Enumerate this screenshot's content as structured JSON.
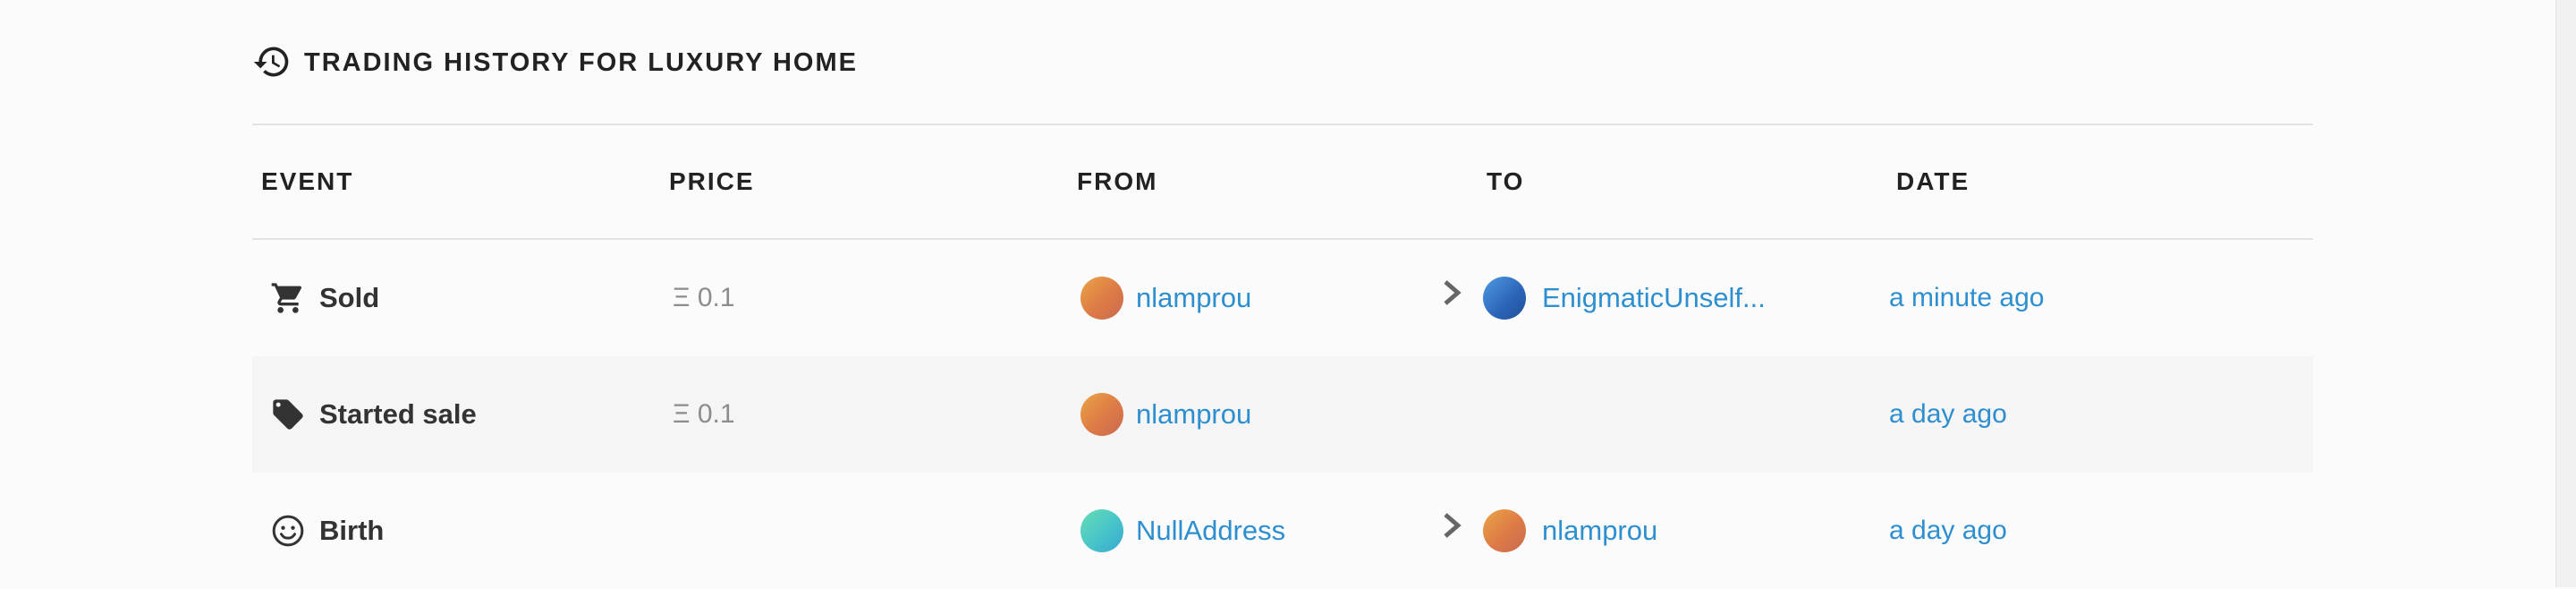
{
  "header": {
    "title": "TRADING HISTORY FOR LUXURY HOME",
    "icon": "history-icon"
  },
  "columns": {
    "event": "EVENT",
    "price": "PRICE",
    "from": "FROM",
    "to": "TO",
    "date": "DATE"
  },
  "rows": [
    {
      "event": "Sold",
      "event_icon": "cart-icon",
      "price": "Ξ 0.1",
      "from": "nlamprou",
      "from_avatar": "orange",
      "to": "EnigmaticUnself...",
      "to_avatar": "blue",
      "date": "a minute ago"
    },
    {
      "event": "Started sale",
      "event_icon": "tag-icon",
      "price": "Ξ 0.1",
      "from": "nlamprou",
      "from_avatar": "orange",
      "to": "",
      "to_avatar": "",
      "date": "a day ago"
    },
    {
      "event": "Birth",
      "event_icon": "smile-icon",
      "price": "",
      "from": "NullAddress",
      "from_avatar": "teal",
      "to": "nlamprou",
      "to_avatar": "orange",
      "date": "a day ago"
    }
  ],
  "colors": {
    "link": "#2d8fd0",
    "text": "#333333",
    "muted": "#8c8c8c",
    "divider": "#e3e3e3"
  }
}
